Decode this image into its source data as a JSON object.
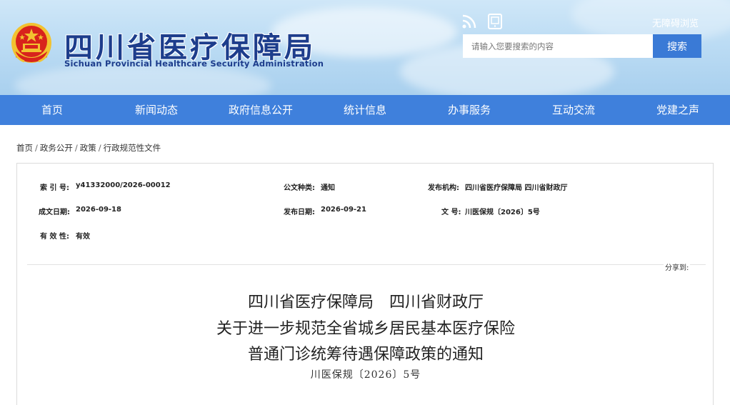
{
  "header": {
    "title": "四川省医疗保障局",
    "subtitle": "Sichuan Provincial Healthcare Security Administration",
    "accessibility_link": "无障碍浏览",
    "search": {
      "placeholder": "请输入您要搜索的内容",
      "button_label": "搜索"
    },
    "icons": [
      "national-emblem-icon",
      "rss-icon",
      "mobile-icon"
    ]
  },
  "nav": {
    "items": [
      "首页",
      "新闻动态",
      "政府信息公开",
      "统计信息",
      "办事服务",
      "互动交流",
      "党建之声"
    ]
  },
  "breadcrumb": [
    "首页",
    "政务公开",
    "政策",
    "行政规范性文件"
  ],
  "metadata": {
    "index_no": {
      "label": "索 引 号:",
      "value": "y41332000/2026-00012"
    },
    "doc_type": {
      "label": "公文种类:",
      "value": "通知"
    },
    "publisher": {
      "label": "发布机构:",
      "value": "四川省医疗保障局 四川省财政厅"
    },
    "created_date": {
      "label": "成文日期:",
      "value": "2026-09-18"
    },
    "published_date": {
      "label": "发布日期:",
      "value": "2026-09-21"
    },
    "doc_no": {
      "label": "文 号:",
      "value": "川医保规〔2026〕5号"
    },
    "validity": {
      "label": "有 效 性:",
      "value": "有效"
    }
  },
  "share_label": "分享到:",
  "document": {
    "title_lines": [
      "四川省医疗保障局　四川省财政厅",
      "关于进一步规范全省城乡居民基本医疗保险",
      "普通门诊统筹待遇保障政策的通知"
    ],
    "number": "川医保规〔2026〕5号"
  },
  "colors": {
    "primary_blue": "#3f80dc",
    "title_blue": "#1d3d8c",
    "emblem_red": "#d8231c",
    "emblem_gold": "#f2c230"
  }
}
